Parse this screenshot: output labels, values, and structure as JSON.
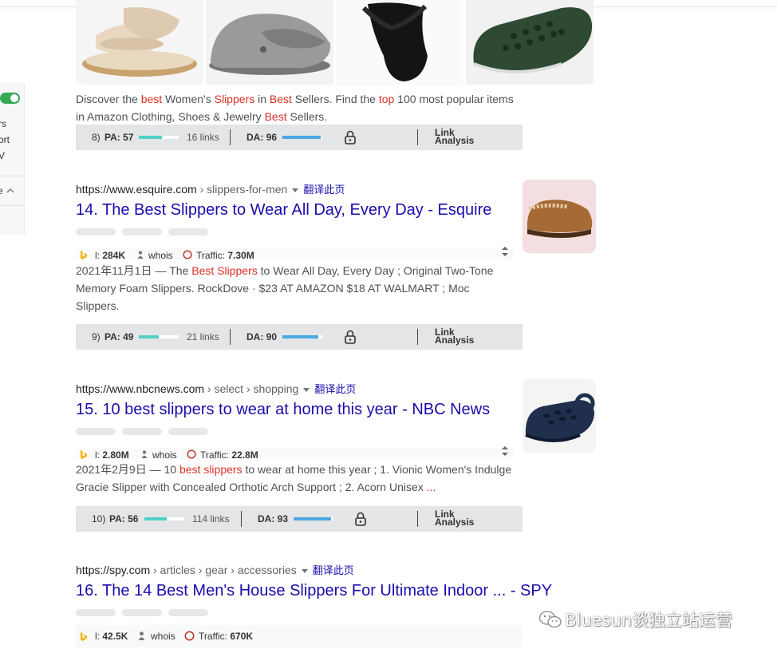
{
  "left_panel": {
    "texts": [
      "rs",
      "ort",
      "V",
      "e"
    ]
  },
  "top_result": {
    "snippet_parts": [
      {
        "t": "Discover the ",
        "h": false
      },
      {
        "t": "best",
        "h": true
      },
      {
        "t": " Women's ",
        "h": false
      },
      {
        "t": "Slippers",
        "h": true
      },
      {
        "t": " in ",
        "h": false
      },
      {
        "t": "Best",
        "h": true
      },
      {
        "t": " Sellers. Find the ",
        "h": false
      },
      {
        "t": "top",
        "h": true
      },
      {
        "t": " 100 most popular items in Amazon Clothing, Shoes & Jewelry ",
        "h": false
      },
      {
        "t": "Best",
        "h": true
      },
      {
        "t": " Sellers.",
        "h": false
      }
    ],
    "moz": {
      "rank": "8)",
      "pa": "PA: 57",
      "pa_fill": 0.57,
      "links": "16 links",
      "da": "DA: 96",
      "da_fill": 0.96,
      "link_analysis_1": "Link",
      "link_analysis_2": "Analysis"
    }
  },
  "results": [
    {
      "url_host": "https://www.esquire.com",
      "url_path": " › slippers-for-men",
      "translate": "翻译此页",
      "number": "14.",
      "title": "The Best Slippers to Wear All Day, Every Day - Esquire",
      "metrics": {
        "l": "l: ",
        "l_val": "284K",
        "whois": "whois",
        "traffic": "Traffic: ",
        "traffic_val": "7.30M"
      },
      "snippet_parts": [
        {
          "t": "2021年11月1日 — The ",
          "h": false
        },
        {
          "t": "Best Slippers",
          "h": true
        },
        {
          "t": " to Wear All Day, Every Day ; Original Two-Tone Memory Foam Slippers. RockDove · $23 AT AMAZON $18 AT WALMART ; Moc Slippers.",
          "h": false
        }
      ],
      "moz": {
        "rank": "9)",
        "pa": "PA: 49",
        "pa_fill": 0.49,
        "links": "21 links",
        "da": "DA: 90",
        "da_fill": 0.9,
        "link_analysis_1": "Link",
        "link_analysis_2": "Analysis"
      }
    },
    {
      "url_host": "https://www.nbcnews.com",
      "url_path": " › select › shopping",
      "translate": "翻译此页",
      "number": "15.",
      "title": "10 best slippers to wear at home this year - NBC News",
      "metrics": {
        "l": "l: ",
        "l_val": "2.80M",
        "whois": "whois",
        "traffic": "Traffic: ",
        "traffic_val": "22.8M"
      },
      "snippet_parts": [
        {
          "t": "2021年2月9日 — 10 ",
          "h": false
        },
        {
          "t": "best slippers",
          "h": true
        },
        {
          "t": " to wear at home this year ; 1. Vionic Women's Indulge Gracie Slipper with Concealed Orthotic Arch Support ; 2. Acorn Unisex ",
          "h": false
        },
        {
          "t": "...",
          "h": true
        }
      ],
      "moz": {
        "rank": "10)",
        "pa": "PA: 56",
        "pa_fill": 0.56,
        "links": "114 links",
        "da": "DA: 93",
        "da_fill": 0.93,
        "link_analysis_1": "Link",
        "link_analysis_2": "Analysis"
      }
    },
    {
      "url_host": "https://spy.com",
      "url_path": " › articles › gear › accessories",
      "translate": "翻译此页",
      "number": "16.",
      "title": "The 14 Best Men's House Slippers For Ultimate Indoor ... - SPY",
      "metrics": {
        "l": "l: ",
        "l_val": "42.5K",
        "whois": "whois",
        "traffic": "Traffic: ",
        "traffic_val": "670K"
      }
    }
  ],
  "watermark": "Bluesun谈独立站运营",
  "colors": {
    "link": "#1a0dab",
    "highlight": "#d93025",
    "pa_bar": "#4fd1c5",
    "da_bar": "#4aa8e0",
    "mozbar_bg": "#e3e5e6"
  }
}
